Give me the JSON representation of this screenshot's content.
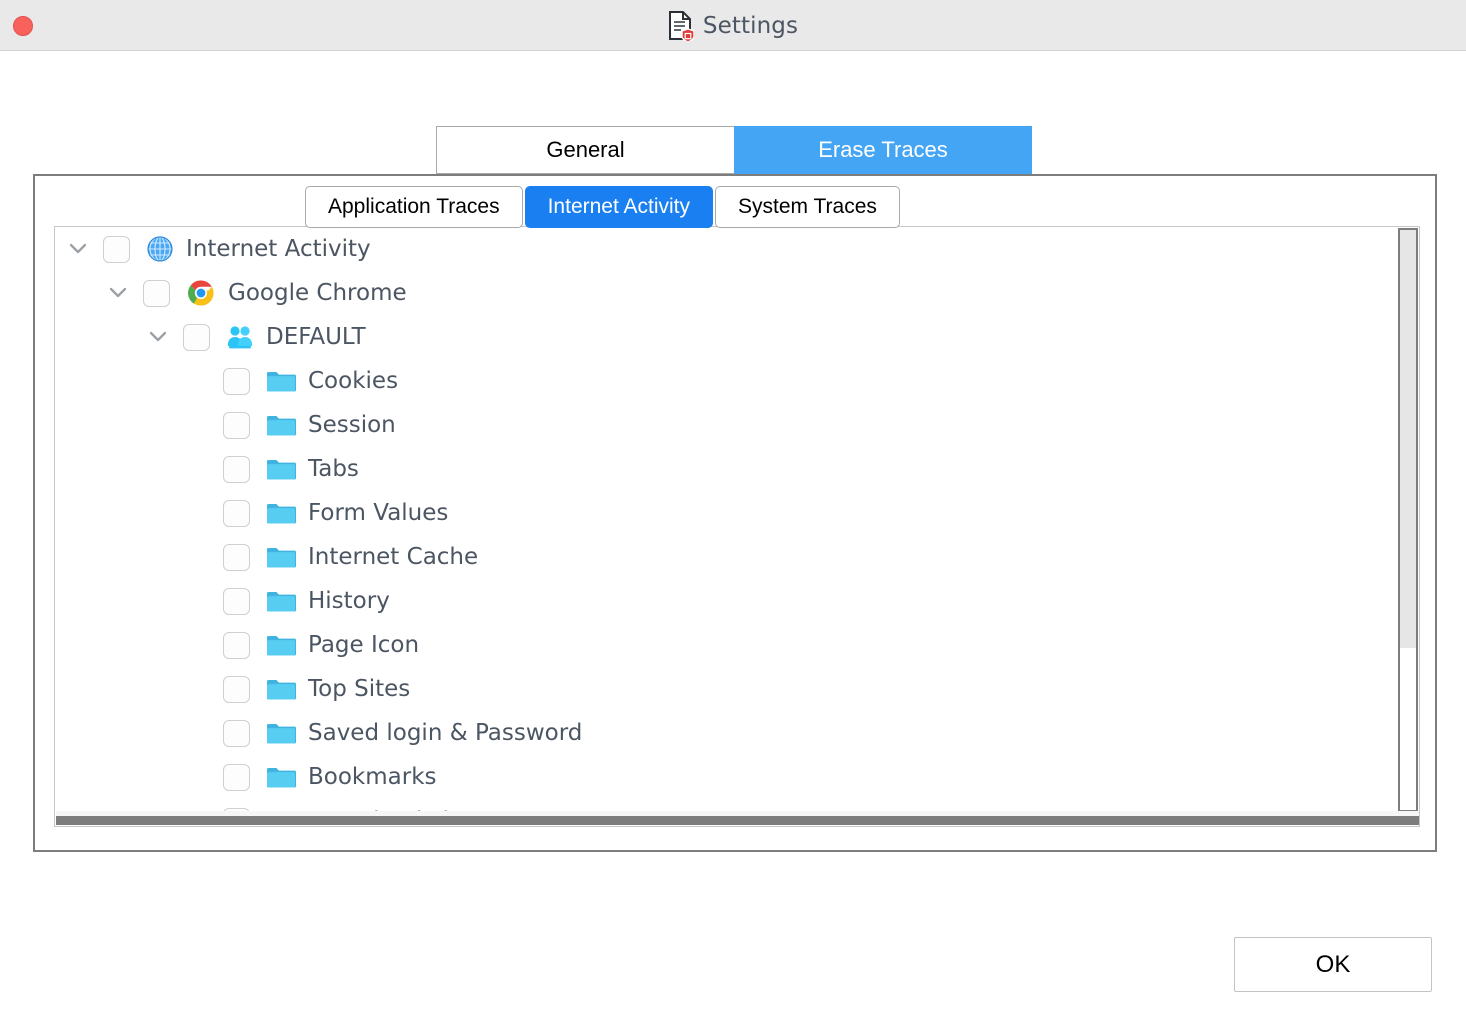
{
  "window": {
    "title": "Settings",
    "title_icon": "document-shield-icon",
    "close_button_color": "#f9615c"
  },
  "main_tabs": [
    {
      "label": "General",
      "active": false
    },
    {
      "label": "Erase Traces",
      "active": true
    }
  ],
  "sub_tabs": [
    {
      "label": "Application Traces",
      "active": false
    },
    {
      "label": "Internet Activity",
      "active": true
    },
    {
      "label": "System Traces",
      "active": false
    }
  ],
  "tree": [
    {
      "label": "Internet Activity",
      "icon": "globe-icon",
      "depth": 0,
      "expanded": true,
      "checked": false
    },
    {
      "label": "Google Chrome",
      "icon": "chrome-icon",
      "depth": 1,
      "expanded": true,
      "checked": false
    },
    {
      "label": "DEFAULT",
      "icon": "users-icon",
      "depth": 2,
      "expanded": true,
      "checked": false
    },
    {
      "label": "Cookies",
      "icon": "folder-icon",
      "depth": 3,
      "checked": false
    },
    {
      "label": "Session",
      "icon": "folder-icon",
      "depth": 3,
      "checked": false
    },
    {
      "label": "Tabs",
      "icon": "folder-icon",
      "depth": 3,
      "checked": false
    },
    {
      "label": "Form Values",
      "icon": "folder-icon",
      "depth": 3,
      "checked": false
    },
    {
      "label": "Internet Cache",
      "icon": "folder-icon",
      "depth": 3,
      "checked": false
    },
    {
      "label": "History",
      "icon": "folder-icon",
      "depth": 3,
      "checked": false
    },
    {
      "label": "Page Icon",
      "icon": "folder-icon",
      "depth": 3,
      "checked": false
    },
    {
      "label": "Top Sites",
      "icon": "folder-icon",
      "depth": 3,
      "checked": false
    },
    {
      "label": "Saved login & Password",
      "icon": "folder-icon",
      "depth": 3,
      "checked": false
    },
    {
      "label": "Bookmarks",
      "icon": "folder-icon",
      "depth": 3,
      "checked": false
    },
    {
      "label": "Download List",
      "icon": "folder-icon",
      "depth": 3,
      "checked": false
    }
  ],
  "scrollbar": {
    "vertical_thumb_percent": 72,
    "horizontal_thumb_percent": 100
  },
  "footer": {
    "ok_label": "OK"
  },
  "colors": {
    "titlebar_bg": "#e9e9e9",
    "active_main_tab": "#44a5f5",
    "active_sub_tab": "#1a7ff0",
    "folder_icon": "#4ec3ef",
    "label_text": "#4c5663",
    "panel_border": "#7d7d7d"
  }
}
